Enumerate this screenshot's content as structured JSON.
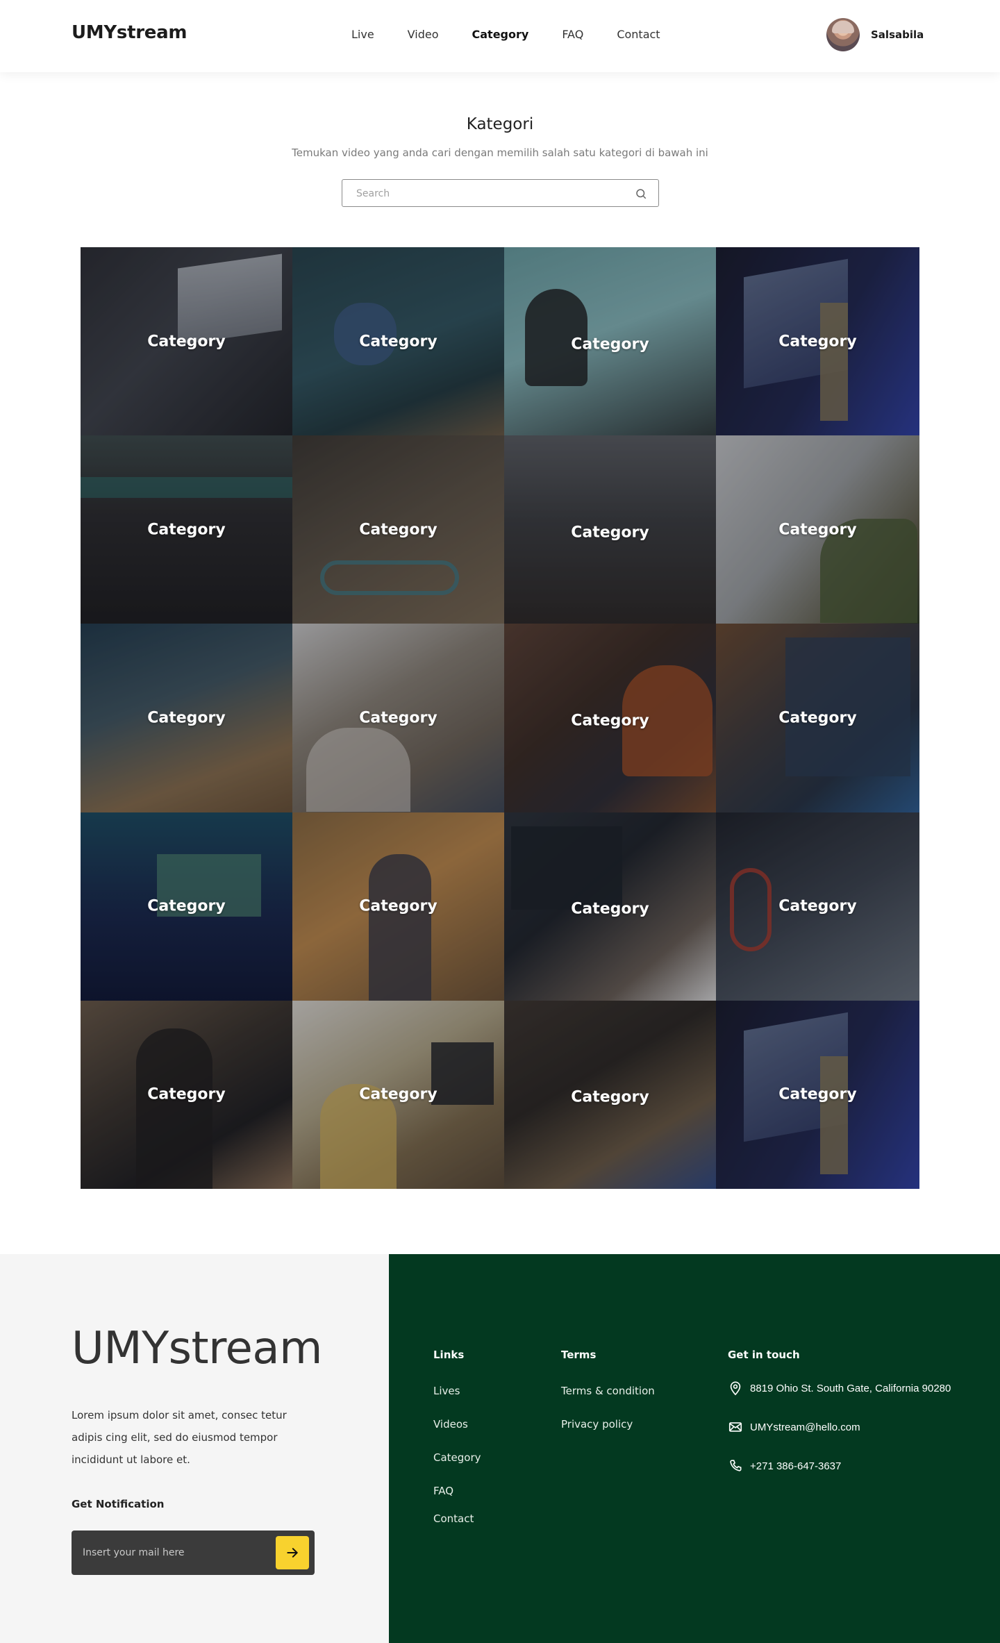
{
  "header": {
    "logo": "UMYstream",
    "nav": [
      {
        "label": "Live"
      },
      {
        "label": "Video"
      },
      {
        "label": "Category",
        "active": true
      },
      {
        "label": "FAQ"
      },
      {
        "label": "Contact"
      }
    ],
    "user_name": "Salsabila"
  },
  "hero": {
    "title": "Kategori",
    "subtitle": "Temukan video yang anda cari dengan memilih salah satu kategori di bawah ini",
    "search_placeholder": "Search",
    "search_icon": "search-icon"
  },
  "categories": [
    "Category",
    "Category",
    "Category",
    "Category",
    "Category",
    "Category",
    "Category",
    "Category",
    "Category",
    "Category",
    "Category",
    "Category",
    "Category",
    "Category",
    "Category",
    "Category",
    "Category",
    "Category",
    "Category",
    "Category"
  ],
  "footer": {
    "logo": "UMYstream",
    "description": "Lorem ipsum dolor sit amet, consec tetur adipis cing elit, sed do eiusmod tempor incididunt ut labore et.",
    "notification_title": "Get Notification",
    "email_placeholder": "Insert your mail here",
    "links": {
      "title": "Links",
      "items": [
        "Lives",
        "Videos",
        "Category",
        "FAQ",
        "Contact"
      ]
    },
    "terms": {
      "title": "Terms",
      "items": [
        "Terms & condition",
        "Privacy policy"
      ]
    },
    "contact": {
      "title": "Get in touch",
      "address": "8819 Ohio St. South Gate, California 90280",
      "email": "UMYstream@hello.com",
      "phone": "+271 386-647-3637"
    },
    "colors": {
      "dark_green": "#033920",
      "accent_yellow": "#f8d22e",
      "light_gray": "#f5f5f5"
    }
  }
}
